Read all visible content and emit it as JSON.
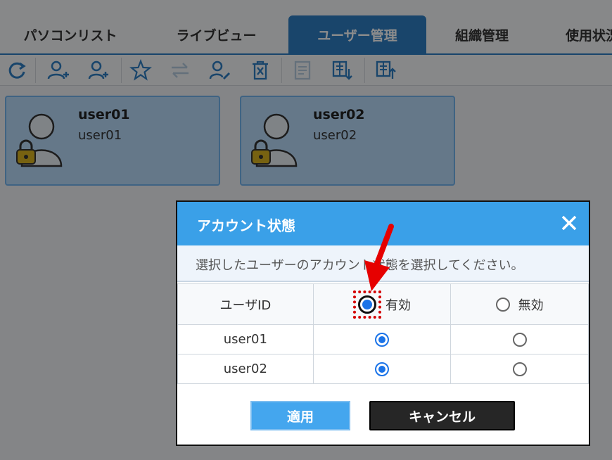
{
  "tabs": [
    {
      "label": "パソコンリスト",
      "active": false
    },
    {
      "label": "ライブビュー",
      "active": false
    },
    {
      "label": "ユーザー管理",
      "active": true
    },
    {
      "label": "組織管理",
      "active": false
    },
    {
      "label": "使用状況",
      "active": false
    }
  ],
  "toolbar": {
    "icons": [
      "refresh-icon",
      "add-user-group-icon",
      "add-user-icon",
      "favorite-icon",
      "transfer-icon",
      "edit-user-icon",
      "delete-icon",
      "document-icon",
      "import-icon",
      "export-icon"
    ]
  },
  "users": [
    {
      "name": "user01",
      "id": "user01"
    },
    {
      "name": "user02",
      "id": "user02"
    }
  ],
  "dialog": {
    "title": "アカウント状態",
    "description": "選択したユーザーのアカウント状態を選択してください。",
    "columns": {
      "user_id": "ユーザID",
      "enabled": "有効",
      "disabled": "無効"
    },
    "rows": [
      {
        "user_id": "user01",
        "state": "enabled"
      },
      {
        "user_id": "user02",
        "state": "enabled"
      }
    ],
    "apply_label": "適用",
    "cancel_label": "キャンセル"
  },
  "colors": {
    "accent": "#2f7ec4",
    "header": "#3aa0e8",
    "highlight": "#d40000"
  }
}
